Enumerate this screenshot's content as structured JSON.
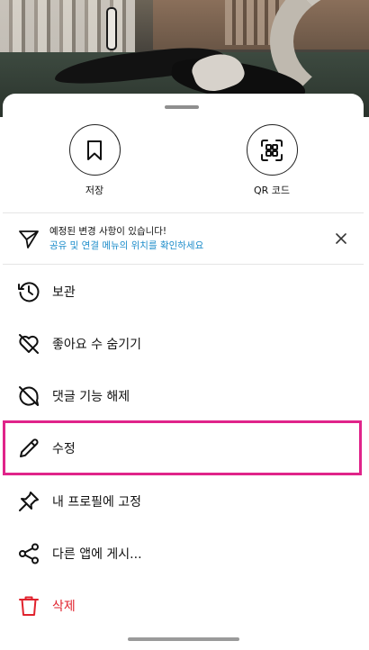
{
  "top_actions": {
    "save_label": "저장",
    "qr_label": "QR 코드"
  },
  "notice": {
    "title": "예정된 변경 사항이 있습니다!",
    "link": "공유 및 연결 메뉴의 위치를 확인하세요"
  },
  "menu": {
    "items": [
      {
        "label": "보관",
        "icon": "archive-history-icon"
      },
      {
        "label": "좋아요 수 숨기기",
        "icon": "heart-crossed-icon"
      },
      {
        "label": "댓글 기능 해제",
        "icon": "comment-off-icon"
      },
      {
        "label": "수정",
        "icon": "pencil-icon"
      },
      {
        "label": "내 프로필에 고정",
        "icon": "pin-icon"
      },
      {
        "label": "다른 앱에 게시...",
        "icon": "share-icon"
      },
      {
        "label": "삭제",
        "icon": "trash-icon"
      }
    ]
  },
  "colors": {
    "link": "#1f8ecb",
    "danger": "#e0222d",
    "highlight": "#e0248a"
  }
}
